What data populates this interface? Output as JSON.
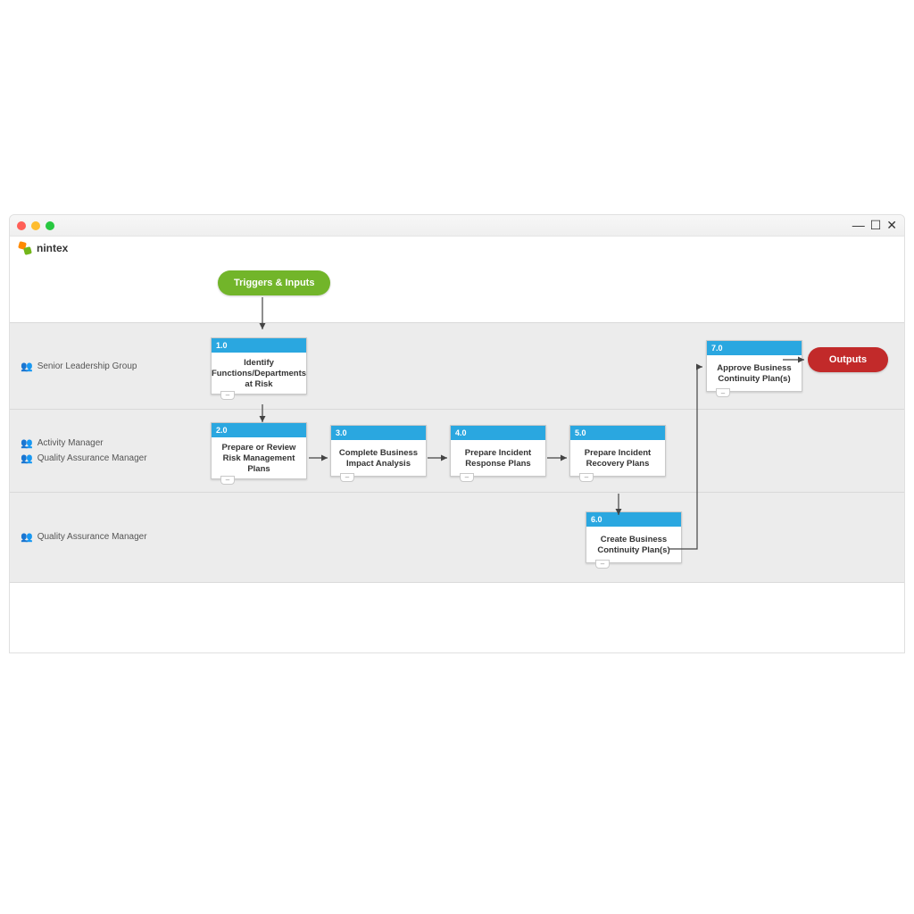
{
  "brand": "nintex",
  "triggers_label": "Triggers & Inputs",
  "outputs_label": "Outputs",
  "lanes": [
    {
      "roles": [
        "Senior Leadership Group"
      ]
    },
    {
      "roles": [
        "Activity Manager",
        "Quality Assurance Manager"
      ]
    },
    {
      "roles": [
        "Quality Assurance Manager"
      ]
    }
  ],
  "steps": {
    "s1": {
      "num": "1.0",
      "title": "Identify Functions/Departments at Risk"
    },
    "s2": {
      "num": "2.0",
      "title": "Prepare or Review Risk Management Plans"
    },
    "s3": {
      "num": "3.0",
      "title": "Complete Business Impact Analysis"
    },
    "s4": {
      "num": "4.0",
      "title": "Prepare Incident Response Plans"
    },
    "s5": {
      "num": "5.0",
      "title": "Prepare Incident Recovery Plans"
    },
    "s6": {
      "num": "6.0",
      "title": "Create Business Continuity Plan(s)"
    },
    "s7": {
      "num": "7.0",
      "title": "Approve Business Continuity Plan(s)"
    }
  }
}
